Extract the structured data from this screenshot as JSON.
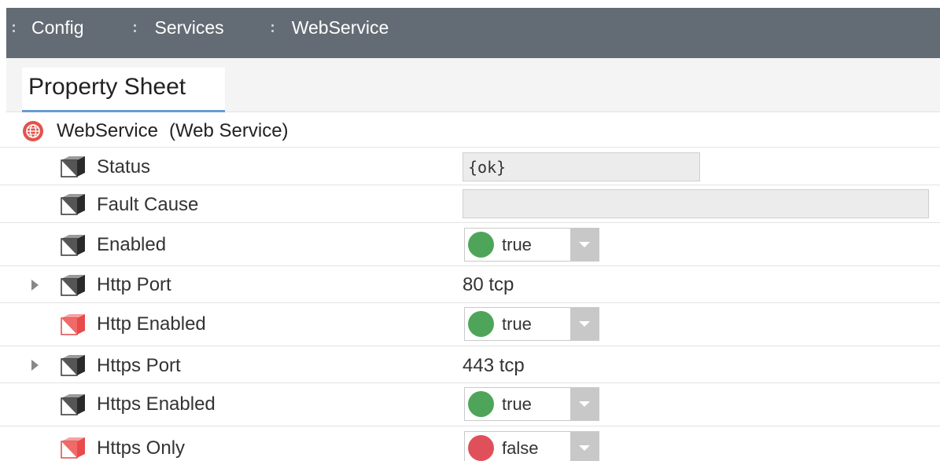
{
  "breadcrumb": [
    {
      "label": "Config"
    },
    {
      "label": "Services"
    },
    {
      "label": "WebService"
    }
  ],
  "tab": {
    "label": "Property Sheet"
  },
  "object": {
    "name": "WebService",
    "type": "(Web Service)"
  },
  "colors": {
    "true_dot": "#4ea55a",
    "false_dot": "#e0505a",
    "breadcrumb_bg": "#636b74",
    "tab_underline": "#6a9ad0"
  },
  "properties": [
    {
      "label": "Status",
      "icon": "cube-gray-icon",
      "value": "{ok}",
      "kind": "readonly"
    },
    {
      "label": "Fault Cause",
      "icon": "cube-gray-icon",
      "value": "",
      "kind": "readonly"
    },
    {
      "label": "Enabled",
      "icon": "cube-gray-icon",
      "value": "true",
      "kind": "bool"
    },
    {
      "label": "Http Port",
      "icon": "cube-gray-icon",
      "value": "80 tcp",
      "kind": "text",
      "expandable": true
    },
    {
      "label": "Http Enabled",
      "icon": "cube-red-icon",
      "value": "true",
      "kind": "bool"
    },
    {
      "label": "Https Port",
      "icon": "cube-gray-icon",
      "value": "443 tcp",
      "kind": "text",
      "expandable": true
    },
    {
      "label": "Https Enabled",
      "icon": "cube-gray-icon",
      "value": "true",
      "kind": "bool"
    },
    {
      "label": "Https Only",
      "icon": "cube-red-icon",
      "value": "false",
      "kind": "bool"
    }
  ]
}
